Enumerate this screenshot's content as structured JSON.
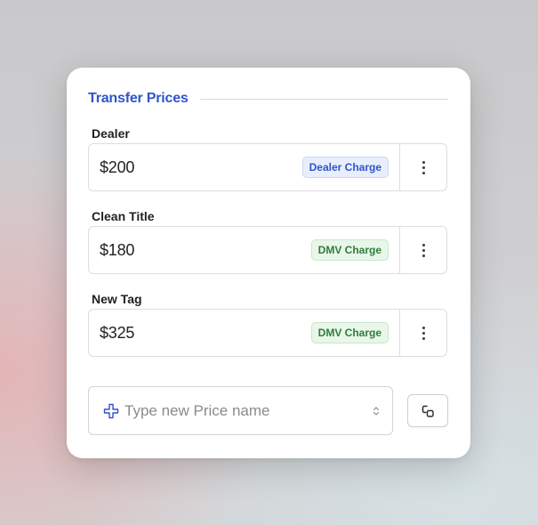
{
  "section": {
    "title": "Transfer Prices"
  },
  "prices": [
    {
      "label": "Dealer",
      "value": "$200",
      "badge": "Dealer Charge",
      "badge_color": "#2f55c9"
    },
    {
      "label": "Clean Title",
      "value": "$180",
      "badge": "DMV Charge",
      "badge_color": "#2e7d3a"
    },
    {
      "label": "New Tag",
      "value": "$325",
      "badge": "DMV Charge",
      "badge_color": "#2e7d3a"
    }
  ],
  "new_price": {
    "placeholder": "Type new Price name"
  },
  "icons": {
    "add": "plus-icon",
    "row_menu": "vertical-dots-icon",
    "select": "up-down-chevron-icon",
    "action": "link-squares-icon"
  },
  "colors": {
    "accent": "#2f55c9",
    "success": "#2e7d3a"
  }
}
